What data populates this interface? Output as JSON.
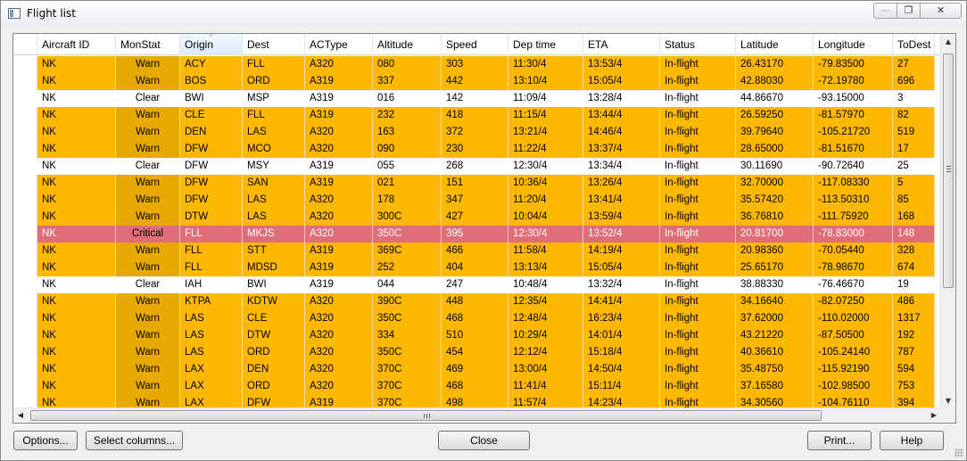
{
  "window": {
    "title": "Flight list",
    "minimize_glyph": "—",
    "maximize_glyph": "❐",
    "close_glyph": "✕"
  },
  "columns": [
    {
      "key": "aircraft_id",
      "label": "Aircraft ID"
    },
    {
      "key": "monstat",
      "label": "MonStat"
    },
    {
      "key": "origin",
      "label": "Origin",
      "sorted": true
    },
    {
      "key": "dest",
      "label": "Dest"
    },
    {
      "key": "actype",
      "label": "ACType"
    },
    {
      "key": "altitude",
      "label": "Altitude"
    },
    {
      "key": "speed",
      "label": "Speed"
    },
    {
      "key": "dep_time",
      "label": "Dep time"
    },
    {
      "key": "eta",
      "label": "ETA"
    },
    {
      "key": "status",
      "label": "Status"
    },
    {
      "key": "latitude",
      "label": "Latitude"
    },
    {
      "key": "longitude",
      "label": "Longitude"
    },
    {
      "key": "todest",
      "label": "ToDest"
    }
  ],
  "rows": [
    [
      "NK",
      "Warn",
      "ACY",
      "FLL",
      "A320",
      "080",
      "303",
      "11:30/4",
      "13:53/4",
      "In-flight",
      "26.43170",
      "-79.83500",
      "27"
    ],
    [
      "NK",
      "Warn",
      "BOS",
      "ORD",
      "A319",
      "337",
      "442",
      "13:10/4",
      "15:05/4",
      "In-flight",
      "42.88030",
      "-72.19780",
      "696"
    ],
    [
      "NK",
      "Clear",
      "BWI",
      "MSP",
      "A319",
      "016",
      "142",
      "11:09/4",
      "13:28/4",
      "In-flight",
      "44.86670",
      "-93.15000",
      "3"
    ],
    [
      "NK",
      "Warn",
      "CLE",
      "FLL",
      "A319",
      "232",
      "418",
      "11:15/4",
      "13:44/4",
      "In-flight",
      "26.59250",
      "-81.57970",
      "82"
    ],
    [
      "NK",
      "Warn",
      "DEN",
      "LAS",
      "A320",
      "163",
      "372",
      "13:21/4",
      "14:46/4",
      "In-flight",
      "39.79640",
      "-105.21720",
      "519"
    ],
    [
      "NK",
      "Warn",
      "DFW",
      "MCO",
      "A320",
      "090",
      "230",
      "11:22/4",
      "13:37/4",
      "In-flight",
      "28.65000",
      "-81.51670",
      "17"
    ],
    [
      "NK",
      "Clear",
      "DFW",
      "MSY",
      "A319",
      "055",
      "268",
      "12:30/4",
      "13:34/4",
      "In-flight",
      "30.11690",
      "-90.72640",
      "25"
    ],
    [
      "NK",
      "Warn",
      "DFW",
      "SAN",
      "A319",
      "021",
      "151",
      "10:36/4",
      "13:26/4",
      "In-flight",
      "32.70000",
      "-117.08330",
      "5"
    ],
    [
      "NK",
      "Warn",
      "DFW",
      "LAS",
      "A320",
      "178",
      "347",
      "11:20/4",
      "13:41/4",
      "In-flight",
      "35.57420",
      "-113.50310",
      "85"
    ],
    [
      "NK",
      "Warn",
      "DTW",
      "LAS",
      "A320",
      "300C",
      "427",
      "10:04/4",
      "13:59/4",
      "In-flight",
      "36.76810",
      "-111.75920",
      "168"
    ],
    [
      "NK",
      "Critical",
      "FLL",
      "MKJS",
      "A320",
      "350C",
      "395",
      "12:30/4",
      "13:52/4",
      "In-flight",
      "20.81700",
      "-78.83000",
      "148"
    ],
    [
      "NK",
      "Warn",
      "FLL",
      "STT",
      "A319",
      "369C",
      "466",
      "11:58/4",
      "14:19/4",
      "In-flight",
      "20.98360",
      "-70.05440",
      "328"
    ],
    [
      "NK",
      "Warn",
      "FLL",
      "MDSD",
      "A319",
      "252",
      "404",
      "13:13/4",
      "15:05/4",
      "In-flight",
      "25.65170",
      "-78.98670",
      "674"
    ],
    [
      "NK",
      "Clear",
      "IAH",
      "BWI",
      "A319",
      "044",
      "247",
      "10:48/4",
      "13:32/4",
      "In-flight",
      "38.88330",
      "-76.46670",
      "19"
    ],
    [
      "NK",
      "Warn",
      "KTPA",
      "KDTW",
      "A320",
      "390C",
      "448",
      "12:35/4",
      "14:41/4",
      "In-flight",
      "34.16640",
      "-82.07250",
      "486"
    ],
    [
      "NK",
      "Warn",
      "LAS",
      "CLE",
      "A320",
      "350C",
      "468",
      "12:48/4",
      "16:23/4",
      "In-flight",
      "37.62000",
      "-110.02000",
      "1317"
    ],
    [
      "NK",
      "Warn",
      "LAS",
      "DTW",
      "A320",
      "334",
      "510",
      "10:29/4",
      "14:01/4",
      "In-flight",
      "43.21220",
      "-87.50500",
      "192"
    ],
    [
      "NK",
      "Warn",
      "LAS",
      "ORD",
      "A320",
      "350C",
      "454",
      "12:12/4",
      "15:18/4",
      "In-flight",
      "40.36610",
      "-105.24140",
      "787"
    ],
    [
      "NK",
      "Warn",
      "LAX",
      "DEN",
      "A320",
      "370C",
      "469",
      "13:00/4",
      "14:50/4",
      "In-flight",
      "35.48750",
      "-115.92190",
      "594"
    ],
    [
      "NK",
      "Warn",
      "LAX",
      "ORD",
      "A320",
      "370C",
      "468",
      "11:41/4",
      "15:11/4",
      "In-flight",
      "37.16580",
      "-102.98500",
      "753"
    ],
    [
      "NK",
      "Warn",
      "LAX",
      "DFW",
      "A319",
      "370C",
      "498",
      "11:57/4",
      "14:23/4",
      "In-flight",
      "34.30560",
      "-104.76110",
      "394"
    ]
  ],
  "status_colors": {
    "Warn": "#ffb800",
    "Clear": "#ffffff",
    "Critical": "#e06e78"
  },
  "icons": {
    "scroll_up": "▲",
    "scroll_down": "▼",
    "scroll_left": "◀",
    "scroll_right": "▶",
    "sort": "^"
  },
  "buttons": {
    "options": "Options...",
    "select_columns": "Select columns...",
    "close": "Close",
    "print": "Print...",
    "help": "Help"
  }
}
